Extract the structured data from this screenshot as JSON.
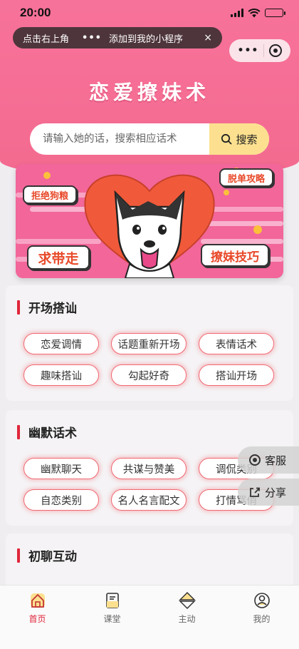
{
  "status_bar": {
    "time": "20:00"
  },
  "tip_bar": {
    "left_text": "点击右上角",
    "dots": "•••",
    "right_text": "添加到我的小程序",
    "close": "×"
  },
  "capsule": {
    "more": "•••"
  },
  "header": {
    "title": "恋爱撩妹术"
  },
  "search": {
    "placeholder": "请输入她的话，搜索相应话术",
    "button_label": "搜索"
  },
  "banner": {
    "bubbles": {
      "top_left": "拒绝狗粮",
      "top_right": "脱单攻略",
      "bottom_left": "求带走",
      "bottom_right": "撩妹技巧"
    },
    "colors": {
      "background": "#f2669a",
      "heart": "#f05a3a"
    }
  },
  "sections": [
    {
      "title": "开场搭讪",
      "tags": [
        "恋爱调情",
        "话题重新开场",
        "表情话术",
        "趣味搭讪",
        "勾起好奇",
        "搭讪开场"
      ]
    },
    {
      "title": "幽默话术",
      "tags": [
        "幽默聊天",
        "共谋与赞美",
        "调侃类别",
        "自恋类别",
        "名人名言配文",
        "打情骂俏"
      ]
    },
    {
      "title": "初聊互动",
      "tags": []
    }
  ],
  "floating": {
    "service": "客服",
    "share": "分享"
  },
  "tabbar": {
    "items": [
      {
        "label": "首页",
        "icon": "home-icon",
        "active": true
      },
      {
        "label": "课堂",
        "icon": "book-icon",
        "active": false
      },
      {
        "label": "主动",
        "icon": "initiative-icon",
        "active": false
      },
      {
        "label": "我的",
        "icon": "profile-icon",
        "active": false
      }
    ]
  },
  "colors": {
    "accent": "#e0263b",
    "header_pink": "#f7729a",
    "search_button": "#fce08f",
    "tag_border": "#f06a72"
  }
}
